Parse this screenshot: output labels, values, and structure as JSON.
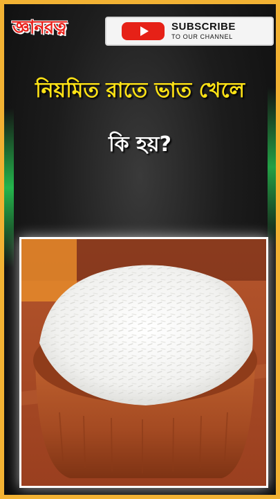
{
  "channel": {
    "logo_text": "জ্ঞানরত্ন"
  },
  "subscribe": {
    "label": "SUBSCRIBE",
    "sublabel": "TO OUR CHANNEL"
  },
  "headline": {
    "line1": "নিয়মিত রাতে ভাত খেলে",
    "line2": "কি হয়?"
  },
  "photo": {
    "description_icon": "rice-bowl-image"
  },
  "colors": {
    "border": "#f2b233",
    "headline": "#ffe315",
    "logo": "#e8201a",
    "youtube_red": "#e62117"
  }
}
